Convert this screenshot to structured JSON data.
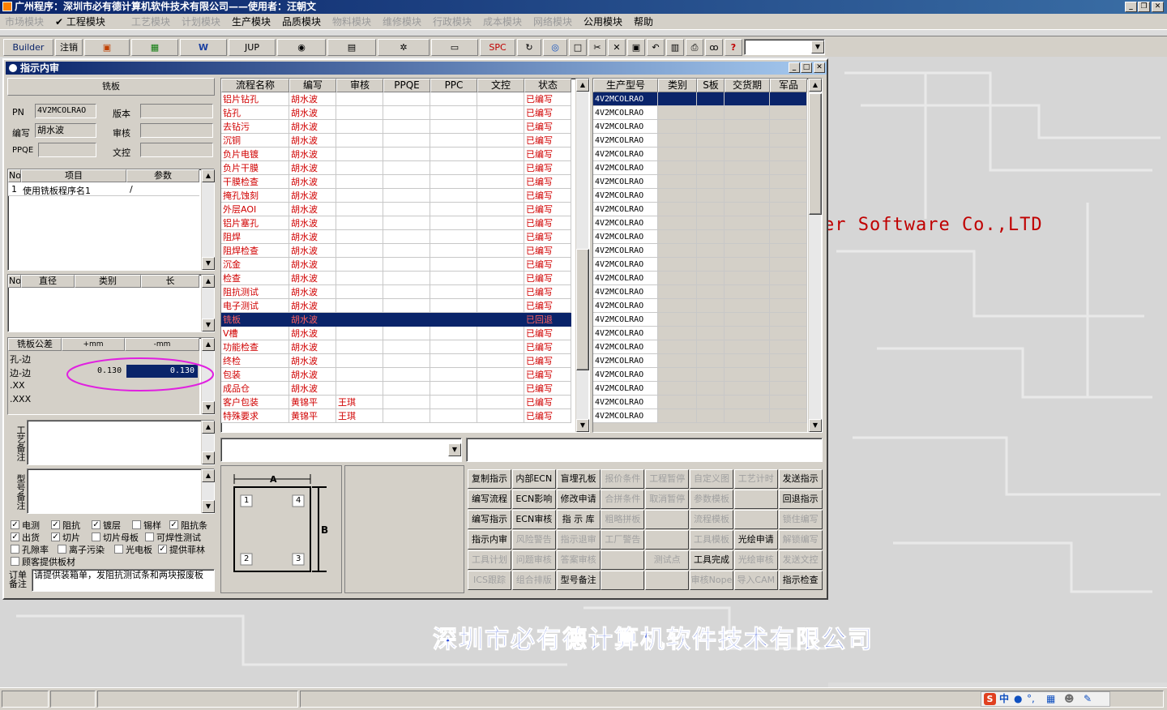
{
  "app": {
    "title": "广州程序：深圳市必有德计算机软件技术有限公司——使用者：汪朝文",
    "company_banner": "深圳市必有德计算机软件技术有限公司",
    "watermark_en": "er Software Co.,LTD"
  },
  "menu": [
    {
      "label": "市场模块",
      "enabled": false
    },
    {
      "label": "✔ 工程模块",
      "enabled": true
    },
    {
      "label": "工艺模块",
      "enabled": false
    },
    {
      "label": "计划模块",
      "enabled": false
    },
    {
      "label": "生产模块",
      "enabled": true
    },
    {
      "label": "品质模块",
      "enabled": true
    },
    {
      "label": "物料模块",
      "enabled": false
    },
    {
      "label": "维修模块",
      "enabled": false
    },
    {
      "label": "行政模块",
      "enabled": false
    },
    {
      "label": "成本模块",
      "enabled": false
    },
    {
      "label": "网络模块",
      "enabled": false
    },
    {
      "label": "公用模块",
      "enabled": true
    },
    {
      "label": "帮助",
      "enabled": true
    }
  ],
  "toolbar": {
    "builder": "Builder",
    "logout": "注销",
    "jup": "JUP",
    "spc": "SPC",
    "help": "?"
  },
  "child": {
    "title": "指示内审",
    "panel_title": "铣板",
    "pn_label": "PN",
    "pn_value": "4V2MCOLRAO",
    "version_label": "版本",
    "version_value": "",
    "author_label": "编写",
    "author_value": "胡水波",
    "review_label": "审核",
    "review_value": "",
    "ppqe_label": "PPQE",
    "ppqe_value": "",
    "doc_label": "文控",
    "doc_value": ""
  },
  "items_table": {
    "headers": [
      "No",
      "项目",
      "参数"
    ],
    "rows": [
      [
        "1",
        "使用铣板程序名1",
        "/"
      ]
    ]
  },
  "drill_table": {
    "headers": [
      "No",
      "直径",
      "类别",
      "长"
    ]
  },
  "tolerance": {
    "headers": [
      "铣板公差",
      "+mm",
      "-mm"
    ],
    "rows": [
      {
        "label": "孔-边",
        "plus": "",
        "minus": ""
      },
      {
        "label": "边-边",
        "plus": "0.130",
        "minus": "0.130"
      },
      {
        "label": ".XX",
        "plus": "",
        "minus": ""
      },
      {
        "label": ".XXX",
        "plus": "",
        "minus": ""
      }
    ]
  },
  "notes": {
    "process_note_label": "工艺备注",
    "model_note_label": "型号备注",
    "order_note_label": "订单备注",
    "order_note_value": "请提供装箱单，发阻抗测试条和两块报废板"
  },
  "checkboxes": [
    {
      "label": "电测",
      "checked": true
    },
    {
      "label": "阻抗",
      "checked": true
    },
    {
      "label": "镀层",
      "checked": true
    },
    {
      "label": "锡样",
      "checked": false
    },
    {
      "label": "阻抗条",
      "checked": true
    },
    {
      "label": "出货",
      "checked": true
    },
    {
      "label": "切片",
      "checked": true
    },
    {
      "label": "切片母板",
      "checked": false
    },
    {
      "label": "可焊性测试",
      "checked": false
    },
    {
      "label": "孔隙率",
      "checked": false
    },
    {
      "label": "离子污染",
      "checked": false
    },
    {
      "label": "光电板",
      "checked": false
    },
    {
      "label": "提供菲林",
      "checked": true
    },
    {
      "label": "顾客提供板材",
      "checked": false
    }
  ],
  "process_grid": {
    "headers": [
      "流程名称",
      "编写",
      "审核",
      "PPQE",
      "PPC",
      "文控",
      "状态"
    ],
    "rows": [
      [
        "铝片钻孔",
        "胡水波",
        "",
        "",
        "",
        "",
        "已编写"
      ],
      [
        "钻孔",
        "胡水波",
        "",
        "",
        "",
        "",
        "已编写"
      ],
      [
        "去钻污",
        "胡水波",
        "",
        "",
        "",
        "",
        "已编写"
      ],
      [
        "沉铜",
        "胡水波",
        "",
        "",
        "",
        "",
        "已编写"
      ],
      [
        "负片电镀",
        "胡水波",
        "",
        "",
        "",
        "",
        "已编写"
      ],
      [
        "负片干膜",
        "胡水波",
        "",
        "",
        "",
        "",
        "已编写"
      ],
      [
        "干膜检查",
        "胡水波",
        "",
        "",
        "",
        "",
        "已编写"
      ],
      [
        "掩孔蚀刻",
        "胡水波",
        "",
        "",
        "",
        "",
        "已编写"
      ],
      [
        "外层AOI",
        "胡水波",
        "",
        "",
        "",
        "",
        "已编写"
      ],
      [
        "铝片塞孔",
        "胡水波",
        "",
        "",
        "",
        "",
        "已编写"
      ],
      [
        "阻焊",
        "胡水波",
        "",
        "",
        "",
        "",
        "已编写"
      ],
      [
        "阻焊检查",
        "胡水波",
        "",
        "",
        "",
        "",
        "已编写"
      ],
      [
        "沉金",
        "胡水波",
        "",
        "",
        "",
        "",
        "已编写"
      ],
      [
        "检查",
        "胡水波",
        "",
        "",
        "",
        "",
        "已编写"
      ],
      [
        "阻抗测试",
        "胡水波",
        "",
        "",
        "",
        "",
        "已编写"
      ],
      [
        "电子测试",
        "胡水波",
        "",
        "",
        "",
        "",
        "已编写"
      ],
      [
        "铣板",
        "胡水波",
        "",
        "",
        "",
        "",
        "已回退"
      ],
      [
        "V槽",
        "胡水波",
        "",
        "",
        "",
        "",
        "已编写"
      ],
      [
        "功能检查",
        "胡水波",
        "",
        "",
        "",
        "",
        "已编写"
      ],
      [
        "终检",
        "胡水波",
        "",
        "",
        "",
        "",
        "已编写"
      ],
      [
        "包装",
        "胡水波",
        "",
        "",
        "",
        "",
        "已编写"
      ],
      [
        "成品仓",
        "胡水波",
        "",
        "",
        "",
        "",
        "已编写"
      ],
      [
        "客户包装",
        "黄锦平",
        "王琪",
        "",
        "",
        "",
        "已编写"
      ],
      [
        "特殊要求",
        "黄锦平",
        "王琪",
        "",
        "",
        "",
        "已编写"
      ]
    ],
    "selected_row": 16
  },
  "model_grid": {
    "headers": [
      "生产型号",
      "类别",
      "S板",
      "交货期",
      "军品"
    ],
    "model": "4V2MCOLRAO",
    "row_count": 24,
    "selected_row": 0
  },
  "panel_diagram": {
    "label_a": "A",
    "label_b": "B",
    "pins": [
      "1",
      "4",
      "2",
      "3"
    ]
  },
  "actions": [
    [
      {
        "label": "复制指示",
        "enabled": true
      },
      {
        "label": "内部ECN",
        "enabled": true
      },
      {
        "label": "盲埋孔板",
        "enabled": true
      },
      {
        "label": "报价条件",
        "enabled": false
      },
      {
        "label": "工程暂停",
        "enabled": false
      },
      {
        "label": "自定义图",
        "enabled": false
      },
      {
        "label": "工艺计时",
        "enabled": false
      },
      {
        "label": "发送指示",
        "enabled": true
      }
    ],
    [
      {
        "label": "编写流程",
        "enabled": true
      },
      {
        "label": "ECN影响",
        "enabled": true
      },
      {
        "label": "修改申请",
        "enabled": true
      },
      {
        "label": "合拼条件",
        "enabled": false
      },
      {
        "label": "取消暂停",
        "enabled": false
      },
      {
        "label": "参数模板",
        "enabled": false
      },
      {
        "label": "",
        "enabled": false
      },
      {
        "label": "回退指示",
        "enabled": true
      }
    ],
    [
      {
        "label": "编写指示",
        "enabled": true
      },
      {
        "label": "ECN审核",
        "enabled": true
      },
      {
        "label": "指 示 库",
        "enabled": true
      },
      {
        "label": "粗略拼板",
        "enabled": false
      },
      {
        "label": "",
        "enabled": false
      },
      {
        "label": "流程模板",
        "enabled": false
      },
      {
        "label": "",
        "enabled": false
      },
      {
        "label": "锁住编写",
        "enabled": false
      }
    ],
    [
      {
        "label": "指示内审",
        "enabled": true
      },
      {
        "label": "风险警告",
        "enabled": false
      },
      {
        "label": "指示退审",
        "enabled": false
      },
      {
        "label": "工厂警告",
        "enabled": false
      },
      {
        "label": "",
        "enabled": false
      },
      {
        "label": "工具模板",
        "enabled": false
      },
      {
        "label": "光绘申请",
        "enabled": true
      },
      {
        "label": "解锁编写",
        "enabled": false
      }
    ],
    [
      {
        "label": "工具计划",
        "enabled": false
      },
      {
        "label": "问题审核",
        "enabled": false
      },
      {
        "label": "答案审核",
        "enabled": false
      },
      {
        "label": "",
        "enabled": false
      },
      {
        "label": "测试点",
        "enabled": false
      },
      {
        "label": "工具完成",
        "enabled": true
      },
      {
        "label": "光绘审核",
        "enabled": false
      },
      {
        "label": "发送文控",
        "enabled": false
      }
    ],
    [
      {
        "label": "ICS跟踪",
        "enabled": false
      },
      {
        "label": "组合排版",
        "enabled": false
      },
      {
        "label": "型号备注",
        "enabled": true
      },
      {
        "label": "",
        "enabled": false
      },
      {
        "label": "",
        "enabled": false
      },
      {
        "label": "审核Nope",
        "enabled": false
      },
      {
        "label": "导入CAM",
        "enabled": false
      },
      {
        "label": "指示检查",
        "enabled": true
      }
    ]
  ],
  "status_tray": {
    "ime": "中"
  }
}
